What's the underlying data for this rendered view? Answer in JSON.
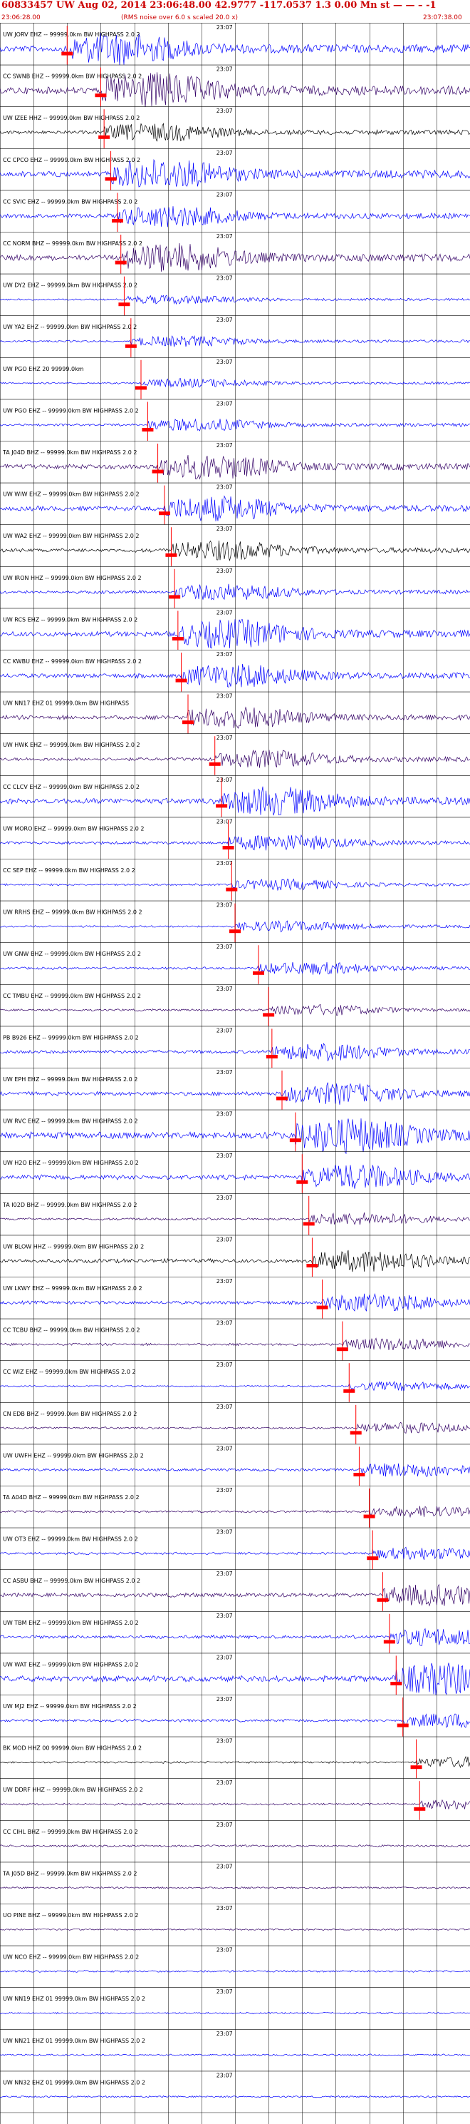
{
  "header": {
    "title": "60833457 UW Aug 02, 2014 23:06:48.00    42.9777 -117.0537  1.3 0.00 Mn st — — –  -1",
    "start_time": "23:06:28.00",
    "rms_note": "(RMS noise over 6.0 s scaled 20.0 x)",
    "end_time": "23:07:38.00"
  },
  "colors": {
    "blue": "#0000ff",
    "purple": "#330066",
    "black": "#000000",
    "pick": "#ff0000"
  },
  "chart_data": {
    "type": "seismogram",
    "time_start": "23:06:28.00",
    "time_end": "23:07:38.00",
    "grid": true,
    "minute_tick_label": "23:07",
    "traces": [
      {
        "label": "UW JORV EHZ -- 99999.0km BW HIGHPASS 2.0 2",
        "color": "blue",
        "pick": 10.0,
        "amp": 0.9
      },
      {
        "label": "CC SWNB EHZ -- 99999.0km BW HIGHPASS 2.0 2",
        "color": "purple",
        "pick": 15.0,
        "amp": 1.0
      },
      {
        "label": "UW IZEE HHZ -- 99999.0km BW HIGHPASS 2.0 2",
        "color": "black",
        "pick": 15.5,
        "amp": 0.5
      },
      {
        "label": "CC CPCO EHZ -- 99999.0km BW HIGHPASS 2.0 2",
        "color": "blue",
        "pick": 16.5,
        "amp": 0.85
      },
      {
        "label": "CC SVIC EHZ -- 99999.0km BW HIGHPASS 2.0 2",
        "color": "blue",
        "pick": 17.5,
        "amp": 0.6
      },
      {
        "label": "CC NORM BHZ -- 99999.0km BW HIGHPASS 2.0 2",
        "color": "purple",
        "pick": 18.0,
        "amp": 0.8
      },
      {
        "label": "UW DY2 EHZ -- 99999.0km BW HIGHPASS 2.0 2",
        "color": "blue",
        "pick": 18.5,
        "amp": 0.25
      },
      {
        "label": "UW YA2 EHZ -- 99999.0km BW HIGHPASS 2.0 2",
        "color": "blue",
        "pick": 19.5,
        "amp": 0.3
      },
      {
        "label": "UW PGO EHZ 20 99999.0km",
        "color": "blue",
        "pick": 21.0,
        "amp": 0.25
      },
      {
        "label": "UW PGO EHZ -- 99999.0km BW HIGHPASS 2.0 2",
        "color": "blue",
        "pick": 22.0,
        "amp": 0.35
      },
      {
        "label": "TA J04D BHZ -- 99999.0km BW HIGHPASS 2.0 2",
        "color": "purple",
        "pick": 23.5,
        "amp": 0.7
      },
      {
        "label": "UW WIW EHZ -- 99999.0km BW HIGHPASS 2.0 2",
        "color": "blue",
        "pick": 24.5,
        "amp": 0.7
      },
      {
        "label": "UW WA2 EHZ -- 99999.0km BW HIGHPASS 2.0 2",
        "color": "black",
        "pick": 25.5,
        "amp": 0.55
      },
      {
        "label": "UW IRON HHZ -- 99999.0km BW HIGHPASS 2.0 2",
        "color": "blue",
        "pick": 26.0,
        "amp": 0.45
      },
      {
        "label": "UW RCS EHZ -- 99999.0km BW HIGHPASS 2.0 2",
        "color": "blue",
        "pick": 26.5,
        "amp": 0.8
      },
      {
        "label": "CC KWBU EHZ -- 99999.0km BW HIGHPASS 2.0 2",
        "color": "blue",
        "pick": 27.0,
        "amp": 0.65
      },
      {
        "label": "UW NN17 EHZ 01 99999.0km BW HIGHPASS",
        "color": "purple",
        "pick": 28.0,
        "amp": 0.6
      },
      {
        "label": "UW HWK EHZ -- 99999.0km BW HIGHPASS 2.0 2",
        "color": "purple",
        "pick": 32.0,
        "amp": 0.5
      },
      {
        "label": "CC CLCV EHZ -- 99999.0km BW HIGHPASS 2.0 2",
        "color": "blue",
        "pick": 33.0,
        "amp": 0.8
      },
      {
        "label": "UW MORO EHZ -- 99999.0km BW HIGHPASS 2.0 2",
        "color": "blue",
        "pick": 34.0,
        "amp": 0.45
      },
      {
        "label": "CC SEP EHZ -- 99999.0km BW HIGHPASS 2.0 2",
        "color": "blue",
        "pick": 34.5,
        "amp": 0.3
      },
      {
        "label": "UW RRHS EHZ -- 99999.0km BW HIGHPASS 2.0 2",
        "color": "blue",
        "pick": 35.0,
        "amp": 0.3
      },
      {
        "label": "UW GNW BHZ -- 99999.0km BW HIGHPASS 2.0 2",
        "color": "blue",
        "pick": 38.5,
        "amp": 0.35
      },
      {
        "label": "CC TMBU EHZ -- 99999.0km BW HIGHPASS 2.0 2",
        "color": "purple",
        "pick": 40.0,
        "amp": 0.3
      },
      {
        "label": "PB B926 EHZ -- 99999.0km BW HIGHPASS 2.0 2",
        "color": "blue",
        "pick": 40.5,
        "amp": 0.5
      },
      {
        "label": "UW EPH EHZ -- 99999.0km BW HIGHPASS 2.0 2",
        "color": "blue",
        "pick": 42.0,
        "amp": 0.6
      },
      {
        "label": "UW RVC EHZ -- 99999.0km BW HIGHPASS 2.0 2",
        "color": "blue",
        "pick": 44.0,
        "amp": 1.0
      },
      {
        "label": "UW H2O EHZ -- 99999.0km BW HIGHPASS 2.0 2",
        "color": "blue",
        "pick": 45.0,
        "amp": 0.7
      },
      {
        "label": "TA I02D BHZ -- 99999.0km BW HIGHPASS 2.0 2",
        "color": "purple",
        "pick": 46.0,
        "amp": 0.35
      },
      {
        "label": "UW BLOW HHZ -- 99999.0km BW HIGHPASS 2.0 2",
        "color": "black",
        "pick": 46.5,
        "amp": 0.6
      },
      {
        "label": "UW LKWY EHZ -- 99999.0km BW HIGHPASS 2.0 2",
        "color": "blue",
        "pick": 48.0,
        "amp": 0.5
      },
      {
        "label": "CC TCBU BHZ -- 99999.0km BW HIGHPASS 2.0 2",
        "color": "purple",
        "pick": 51.0,
        "amp": 0.35
      },
      {
        "label": "CC WIZ EHZ -- 99999.0km BW HIGHPASS 2.0 2",
        "color": "blue",
        "pick": 52.0,
        "amp": 0.25
      },
      {
        "label": "CN EDB BHZ -- 99999.0km BW HIGHPASS 2.0 2",
        "color": "purple",
        "pick": 53.0,
        "amp": 0.3
      },
      {
        "label": "UW UWFH EHZ -- 99999.0km BW HIGHPASS 2.0 2",
        "color": "blue",
        "pick": 53.5,
        "amp": 0.4
      },
      {
        "label": "TA A04D BHZ -- 99999.0km BW HIGHPASS 2.0 2",
        "color": "purple",
        "pick": 55.0,
        "amp": 0.3
      },
      {
        "label": "UW OT3 EHZ -- 99999.0km BW HIGHPASS 2.0 2",
        "color": "blue",
        "pick": 55.5,
        "amp": 0.35
      },
      {
        "label": "CC ASBU BHZ -- 99999.0km BW HIGHPASS 2.0 2",
        "color": "purple",
        "pick": 57.0,
        "amp": 0.6
      },
      {
        "label": "UW TBM EHZ -- 99999.0km BW HIGHPASS 2.0 2",
        "color": "blue",
        "pick": 58.0,
        "amp": 0.5
      },
      {
        "label": "UW WAT EHZ -- 99999.0km BW HIGHPASS 2.0 2",
        "color": "blue",
        "pick": 59.0,
        "amp": 0.9
      },
      {
        "label": "UW MJ2 EHZ -- 99999.0km BW HIGHPASS 2.0 2",
        "color": "blue",
        "pick": 60.0,
        "amp": 0.4
      },
      {
        "label": "BK MOD HHZ 00 99999.0km BW HIGHPASS 2.0 2",
        "color": "black",
        "pick": 62.0,
        "amp": 0.3
      },
      {
        "label": "UW DDRF HHZ -- 99999.0km BW HIGHPASS 2.0 2",
        "color": "purple",
        "pick": 62.5,
        "amp": 0.3
      },
      {
        "label": "CC CIHL BHZ -- 99999.0km BW HIGHPASS 2.0 2",
        "color": "purple",
        "pick": null,
        "amp": 0.3
      },
      {
        "label": "TA J05D BHZ -- 99999.0km BW HIGHPASS 2.0 2",
        "color": "purple",
        "pick": null,
        "amp": 0.25
      },
      {
        "label": "UO PINE BHZ -- 99999.0km BW HIGHPASS 2.0 2",
        "color": "purple",
        "pick": null,
        "amp": 0.25
      },
      {
        "label": "UW NCO EHZ -- 99999.0km BW HIGHPASS 2.0 2",
        "color": "blue",
        "pick": null,
        "amp": 0.3
      },
      {
        "label": "UW NN19 EHZ 01 99999.0km BW HIGHPASS 2.0 2",
        "color": "blue",
        "pick": null,
        "amp": 0.25
      },
      {
        "label": "UW NN21 EHZ 01 99999.0km BW HIGHPASS 2.0 2",
        "color": "blue",
        "pick": null,
        "amp": 0.25
      },
      {
        "label": "UW NN32 EHZ 01 99999.0km BW HIGHPASS 2.0 2",
        "color": "blue",
        "pick": null,
        "amp": 0.25
      }
    ]
  }
}
